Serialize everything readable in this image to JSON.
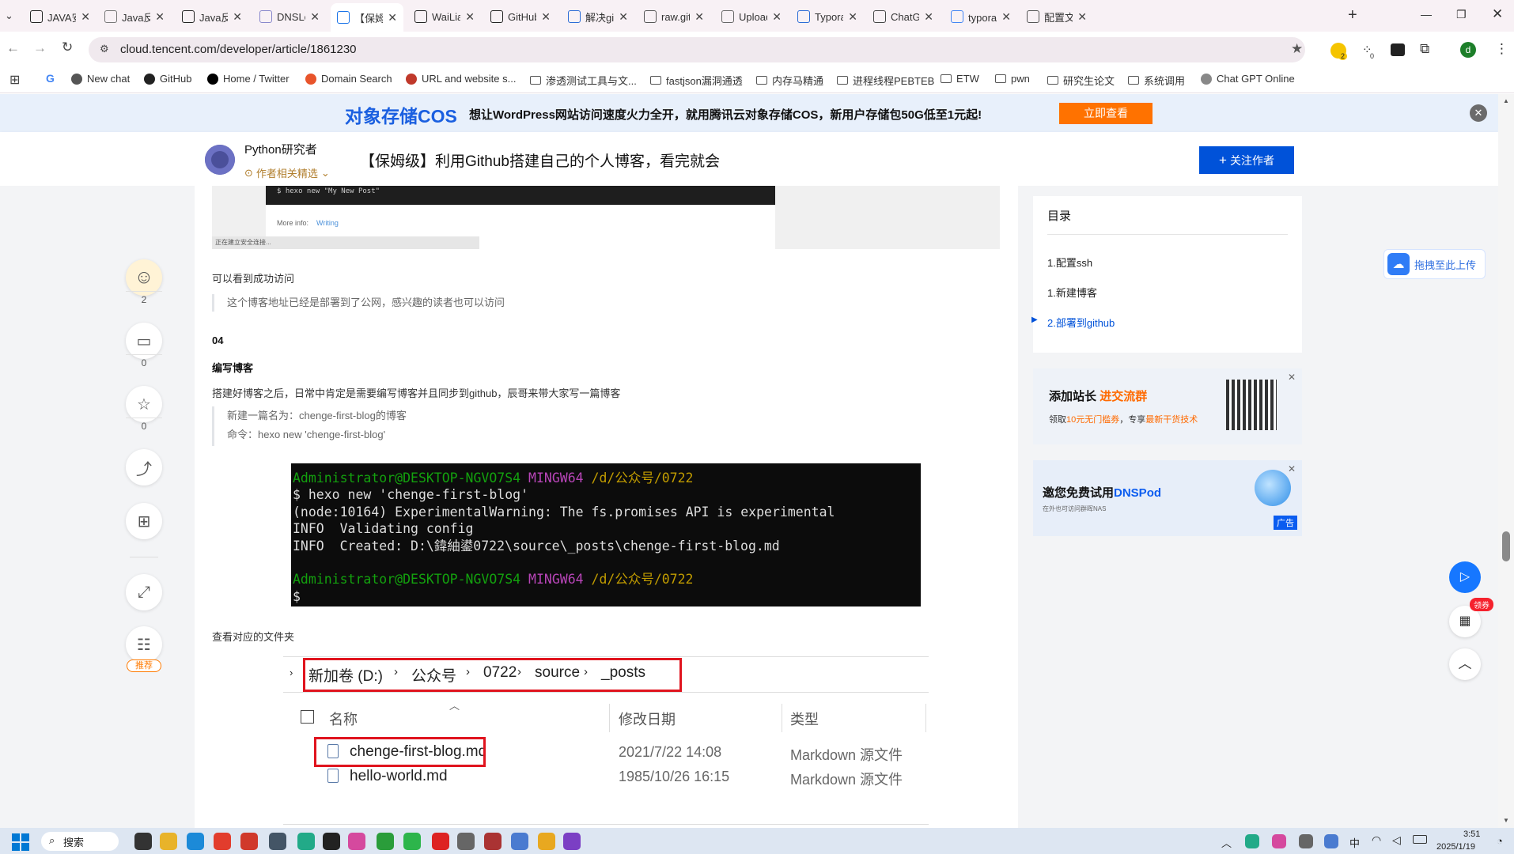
{
  "browser": {
    "tabs": [
      {
        "label": "JAVA安全",
        "icon": "notion-icon"
      },
      {
        "label": "Java反序",
        "icon": "page-icon"
      },
      {
        "label": "Java反序",
        "icon": "notion-icon"
      },
      {
        "label": "DNSLog",
        "icon": "doc-icon"
      },
      {
        "label": "【保姆级",
        "icon": "tencent-cloud-icon"
      },
      {
        "label": "WaiLian",
        "icon": "github-icon"
      },
      {
        "label": "GitHub",
        "icon": "github-icon"
      },
      {
        "label": "解决gith",
        "icon": "site-icon"
      },
      {
        "label": "raw.gith",
        "icon": "globe-icon"
      },
      {
        "label": "Upload",
        "icon": "typora-t-icon"
      },
      {
        "label": "Typora",
        "icon": "site-icon"
      },
      {
        "label": "ChatGP",
        "icon": "openai-icon"
      },
      {
        "label": "typora上",
        "icon": "google-icon"
      },
      {
        "label": "配置文件",
        "icon": "globe-icon"
      }
    ],
    "url": "cloud.tencent.com/developer/article/1861230",
    "extension_badges": [
      "2",
      "0"
    ],
    "profile_letter": "d",
    "bookmarks": [
      {
        "label": "New chat",
        "icon": "openai-icon"
      },
      {
        "label": "GitHub",
        "icon": "github-icon"
      },
      {
        "label": "Home / Twitter",
        "icon": "x-icon"
      },
      {
        "label": "Domain Search",
        "icon": "domain-icon"
      },
      {
        "label": "URL and website s...",
        "icon": "scan-icon"
      },
      {
        "label": "渗透测试工具与文...",
        "icon": "folder-icon"
      },
      {
        "label": "fastjson漏洞通透",
        "icon": "folder-icon"
      },
      {
        "label": "内存马精通",
        "icon": "folder-icon"
      },
      {
        "label": "进程线程PEBTEB",
        "icon": "folder-icon"
      },
      {
        "label": "ETW",
        "icon": "folder-icon"
      },
      {
        "label": "pwn",
        "icon": "folder-icon"
      },
      {
        "label": "研究生论文",
        "icon": "folder-icon"
      },
      {
        "label": "系统调用",
        "icon": "folder-icon"
      },
      {
        "label": "Chat GPT Online",
        "icon": "chat-icon"
      }
    ]
  },
  "banner": {
    "brand": "对象存储COS",
    "text": "想让WordPress网站访问速度火力全开，就用腾讯云对象存储COS，新用户存储包50G低至1元起!",
    "button": "立即查看"
  },
  "header": {
    "author": "Python研究者",
    "author_tag": "作者相关精选",
    "title": "【保姆级】利用Github搭建自己的个人博客，看完就会",
    "follow_button": "关注作者"
  },
  "article": {
    "top_image": {
      "command": "$ hexo new \"My New Post\"",
      "more_info": "More info:",
      "link": "Writing",
      "status": "正在建立安全连接..."
    },
    "p1": "可以看到成功访问",
    "quote1": "这个博客地址已经是部署到了公网，感兴趣的读者也可以访问",
    "section_number": "04",
    "section_title": "编写博客",
    "p2": "搭建好博客之后，日常中肯定是需要编写博客并且同步到github，辰哥来带大家写一篇博客",
    "quote2_line1": "新建一篇名为：chenge-first-blog的博客",
    "quote2_line2": "命令：hexo new 'chenge-first-blog'",
    "terminal": {
      "prompt_user": "Administrator@DESKTOP-NGVO7S4",
      "prompt_shell": "MINGW64",
      "prompt_path": "/d/公众号/0722",
      "line2": "$ hexo new 'chenge-first-blog'",
      "line3": "(node:10164) ExperimentalWarning: The fs.promises API is experimental",
      "line4": "INFO  Validating config",
      "line5": "INFO  Created: D:\\鍏紬鍙0722\\source\\_posts\\chenge-first-blog.md",
      "last_prompt": "$"
    },
    "p3": "查看对应的文件夹",
    "explorer": {
      "breadcrumb": [
        "新加卷 (D:)",
        "公众号",
        "0722",
        "source",
        "_posts"
      ],
      "columns": [
        "名称",
        "修改日期",
        "类型"
      ],
      "rows": [
        {
          "name": "chenge-first-blog.md",
          "date": "2021/7/22 14:08",
          "type": "Markdown 源文件"
        },
        {
          "name": "hello-world.md",
          "date": "1985/10/26 16:15",
          "type": "Markdown 源文件"
        }
      ]
    }
  },
  "left_actions": {
    "like_count": "2",
    "comment_count": "0",
    "star_count": "0",
    "recommend_label": "推荐"
  },
  "toc": {
    "title": "目录",
    "items": [
      {
        "label": "1.配置ssh",
        "active": false
      },
      {
        "label": "1.新建博客",
        "active": false
      },
      {
        "label": "2.部署到github",
        "active": true
      }
    ]
  },
  "ads": {
    "card1": {
      "title_a": "添加站长",
      "title_b": "进交流群",
      "sub_a": "领取",
      "sub_b": "10元无门槛券",
      "sub_c": "，专享",
      "sub_d": "最新干货技术"
    },
    "card2": {
      "title_a": "邀您免费试用",
      "title_b": "DNSPod",
      "sub": "在外也可访问群晖NAS",
      "badge": "广告"
    }
  },
  "right_float": {
    "upload_label": "拖拽至此上传",
    "coupon_badge": "领券"
  },
  "taskbar": {
    "search_label": "搜索",
    "ime": "中",
    "time": "3:51",
    "date": "2025/1/19"
  },
  "colors": {
    "accent": "#0052d9",
    "banner_button": "#ff7200",
    "terminal_green": "#13a10e",
    "terminal_magenta": "#b845b8",
    "terminal_yellow": "#c19c00",
    "red_highlight": "#e0141e"
  }
}
